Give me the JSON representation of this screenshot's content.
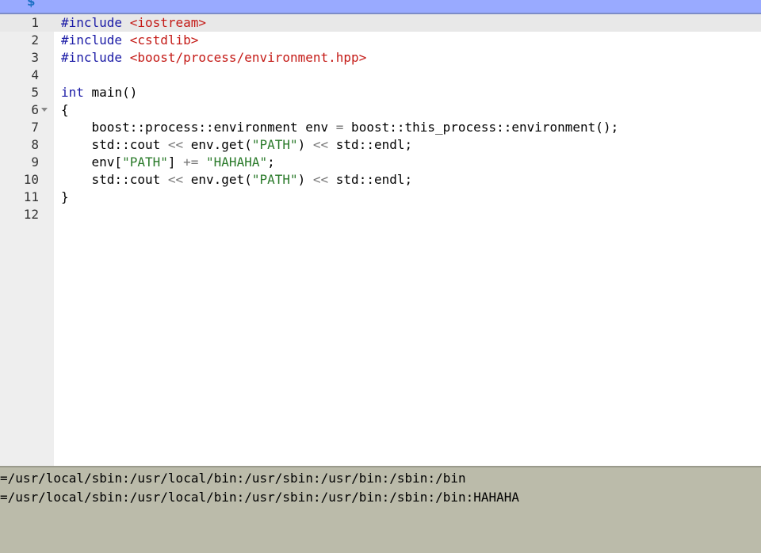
{
  "toolbar": {
    "dollar_glyph": "$"
  },
  "editor": {
    "lines": [
      {
        "n": "1",
        "tokens": [
          {
            "t": "#include ",
            "c": "kw"
          },
          {
            "t": "<iostream>",
            "c": "inc"
          }
        ]
      },
      {
        "n": "2",
        "tokens": [
          {
            "t": "#include ",
            "c": "kw"
          },
          {
            "t": "<cstdlib>",
            "c": "inc"
          }
        ]
      },
      {
        "n": "3",
        "tokens": [
          {
            "t": "#include ",
            "c": "kw"
          },
          {
            "t": "<boost/process/environment.hpp>",
            "c": "inc"
          }
        ]
      },
      {
        "n": "4",
        "tokens": []
      },
      {
        "n": "5",
        "tokens": [
          {
            "t": "int",
            "c": "kw"
          },
          {
            "t": " main()",
            "c": ""
          }
        ]
      },
      {
        "n": "6",
        "fold": true,
        "tokens": [
          {
            "t": "{",
            "c": ""
          }
        ]
      },
      {
        "n": "7",
        "tokens": [
          {
            "t": "    boost::process::environment env ",
            "c": ""
          },
          {
            "t": "=",
            "c": "op"
          },
          {
            "t": " boost::this_process::environment();",
            "c": ""
          }
        ]
      },
      {
        "n": "8",
        "tokens": [
          {
            "t": "    std::cout ",
            "c": ""
          },
          {
            "t": "<<",
            "c": "op"
          },
          {
            "t": " env.get(",
            "c": ""
          },
          {
            "t": "\"PATH\"",
            "c": "str"
          },
          {
            "t": ") ",
            "c": ""
          },
          {
            "t": "<<",
            "c": "op"
          },
          {
            "t": " std::endl;",
            "c": ""
          }
        ]
      },
      {
        "n": "9",
        "tokens": [
          {
            "t": "    env[",
            "c": ""
          },
          {
            "t": "\"PATH\"",
            "c": "str"
          },
          {
            "t": "] ",
            "c": ""
          },
          {
            "t": "+=",
            "c": "op"
          },
          {
            "t": " ",
            "c": ""
          },
          {
            "t": "\"HAHAHA\"",
            "c": "str"
          },
          {
            "t": ";",
            "c": ""
          }
        ]
      },
      {
        "n": "10",
        "tokens": [
          {
            "t": "    std::cout ",
            "c": ""
          },
          {
            "t": "<<",
            "c": "op"
          },
          {
            "t": " env.get(",
            "c": ""
          },
          {
            "t": "\"PATH\"",
            "c": "str"
          },
          {
            "t": ") ",
            "c": ""
          },
          {
            "t": "<<",
            "c": "op"
          },
          {
            "t": " std::endl;",
            "c": ""
          }
        ]
      },
      {
        "n": "11",
        "tokens": [
          {
            "t": "}",
            "c": ""
          }
        ]
      },
      {
        "n": "12",
        "tokens": []
      }
    ]
  },
  "console": {
    "lines": [
      "=/usr/local/sbin:/usr/local/bin:/usr/sbin:/usr/bin:/sbin:/bin",
      "=/usr/local/sbin:/usr/local/bin:/usr/sbin:/usr/bin:/sbin:/bin:HAHAHA"
    ]
  }
}
